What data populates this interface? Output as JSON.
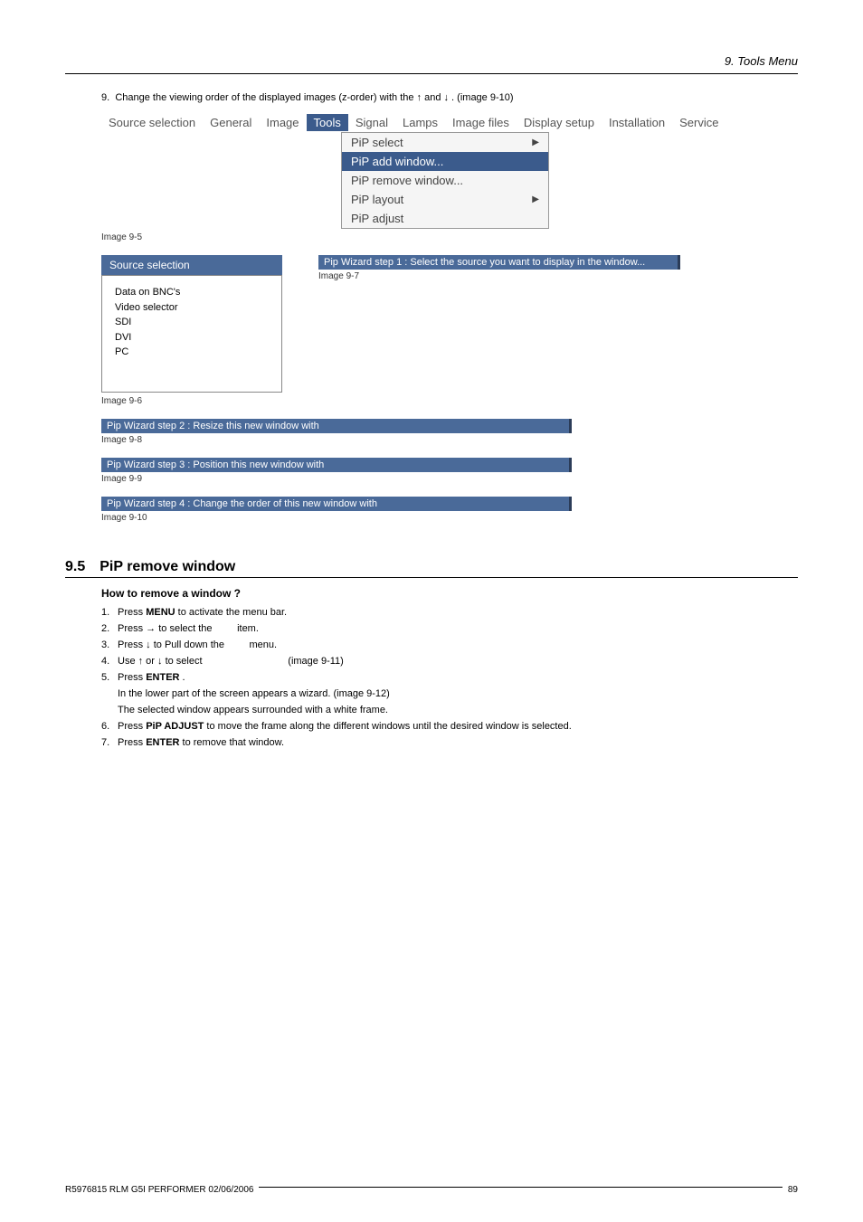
{
  "header": {
    "chapter": "9.  Tools Menu"
  },
  "intro_step": {
    "num": "9.",
    "text": "Change the viewing order of the displayed images (z-order) with the ↑ and ↓ .  (image 9-10)"
  },
  "menubar": {
    "items": [
      "Source selection",
      "General",
      "Image",
      "Tools",
      "Signal",
      "Lamps",
      "Image files",
      "Display setup",
      "Installation",
      "Service"
    ],
    "active_index": 3
  },
  "dropdown": {
    "items": [
      {
        "label": "PiP select",
        "arrow": true,
        "hl": false
      },
      {
        "label": "PiP add window...",
        "arrow": false,
        "hl": true
      },
      {
        "label": "PiP remove window...",
        "arrow": false,
        "hl": false
      },
      {
        "label": "PiP layout",
        "arrow": true,
        "hl": false
      },
      {
        "label": "PiP adjust",
        "arrow": false,
        "hl": false
      }
    ]
  },
  "captions": {
    "img95": "Image 9-5",
    "img96": "Image 9-6",
    "img97": "Image 9-7",
    "img98": "Image 9-8",
    "img99": "Image 9-9",
    "img910": "Image 9-10"
  },
  "source_box": {
    "title": "Source selection",
    "items": [
      "Data on BNC's",
      "Video selector",
      "SDI",
      "DVI",
      "PC"
    ]
  },
  "wizard_bars": {
    "step1": "Pip Wizard step 1 : Select the source you want to display in the window...",
    "step2": "Pip Wizard step 2 : Resize this new window with",
    "step3": "Pip Wizard step 3 : Position this new window with",
    "step4": "Pip Wizard step 4 : Change the order of this new window with"
  },
  "section": {
    "num": "9.5",
    "title": "PiP remove window",
    "subhead": "How to remove a window ?",
    "steps": [
      {
        "n": "1.",
        "pre": "Press ",
        "bold": "MENU",
        "post": " to activate the menu bar."
      },
      {
        "n": "2.",
        "pre": "Press → to select the ",
        "gap": "        ",
        "post": "item."
      },
      {
        "n": "3.",
        "pre": "Press ↓ to Pull down the ",
        "gap": "        ",
        "post": "menu."
      },
      {
        "n": "4.",
        "pre": "Use ↑ or ↓ to select ",
        "gap": "                              ",
        "post": "(image 9-11)"
      },
      {
        "n": "5.",
        "pre": "Press ",
        "bold": "ENTER",
        "post": " ."
      },
      {
        "n": "6.",
        "pre": "Press ",
        "bold": "PiP ADJUST",
        "post": " to move the frame along the different windows until the desired window is selected."
      },
      {
        "n": "7.",
        "pre": "Press ",
        "bold": "ENTER",
        "post": " to remove that window."
      }
    ],
    "sub_after_5a": "In the lower part of the screen appears a wizard.  (image 9-12)",
    "sub_after_5b": "The selected window appears surrounded with a white frame."
  },
  "footer": {
    "left": "R5976815  RLM G5I PERFORMER  02/06/2006",
    "right": "89"
  }
}
